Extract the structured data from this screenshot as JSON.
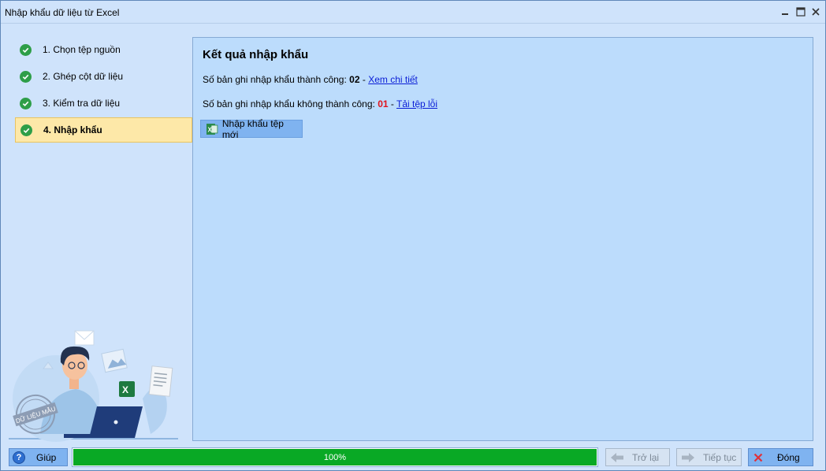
{
  "window": {
    "title": "Nhập khẩu dữ liệu từ Excel"
  },
  "sidebar": {
    "steps": [
      {
        "label": "1. Chọn tệp nguồn"
      },
      {
        "label": "2. Ghép cột dữ liệu"
      },
      {
        "label": "3. Kiểm tra dữ liệu"
      },
      {
        "label": "4. Nhập khẩu"
      }
    ],
    "active_step": 4,
    "illustration_stamp": "DỮ LIỆU MẪU"
  },
  "result": {
    "heading": "Kết quả nhập khẩu",
    "success_label": "Số bản ghi nhập khẩu thành công: ",
    "success_count": "02",
    "success_sep": " - ",
    "success_link": "Xem chi tiết",
    "fail_label": "Số bản ghi nhập khẩu không thành công: ",
    "fail_count": "01",
    "fail_sep": " - ",
    "fail_link": "Tải tệp lỗi",
    "import_new_button": "Nhập khẩu tệp mới"
  },
  "footer": {
    "help_button": "Giúp",
    "progress_value": 100,
    "progress_text": "100%",
    "back_button": "Trở lại",
    "next_button": "Tiếp tục",
    "close_button": "Đóng"
  },
  "colors": {
    "progress_fill": "#09a925",
    "fail_count": "#e0121b",
    "link": "#0a1dd6",
    "active_step_bg": "#fde8a8",
    "check": "#2e9e48"
  }
}
